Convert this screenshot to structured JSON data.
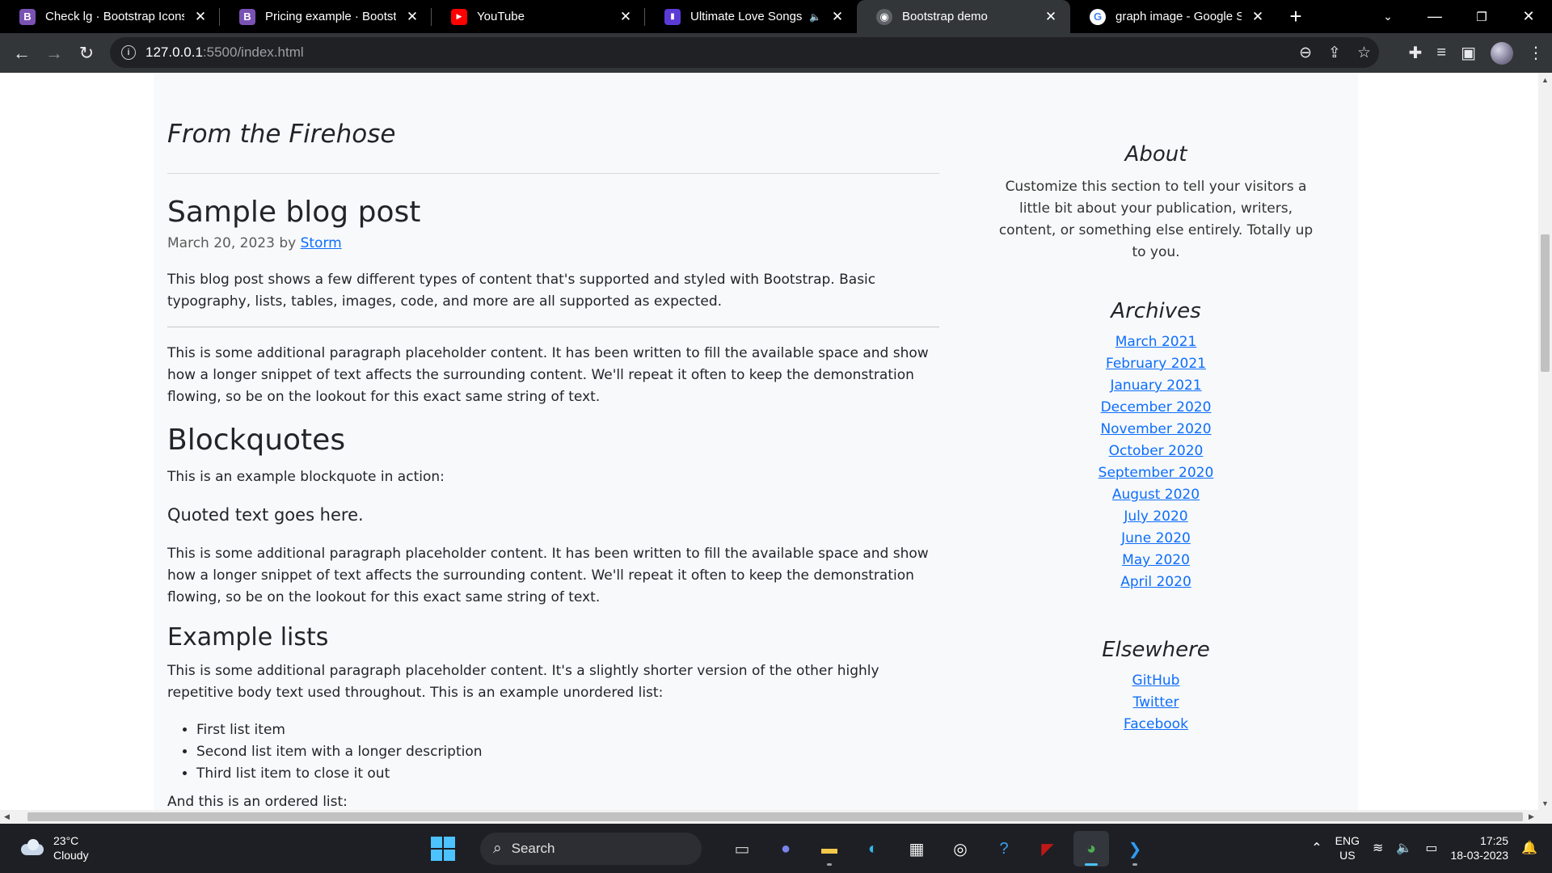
{
  "browser": {
    "tabs": [
      {
        "title": "Check lg · Bootstrap Icons",
        "favicon": "bootstrap-b-icon",
        "fav_color": "#7952b3",
        "fav_text": "B"
      },
      {
        "title": "Pricing example · Bootstrap",
        "favicon": "bootstrap-b-icon",
        "fav_color": "#7952b3",
        "fav_text": "B"
      },
      {
        "title": "YouTube",
        "favicon": "youtube-icon",
        "fav_color": "#ff0000",
        "fav_text": "▶"
      },
      {
        "title": "Ultimate Love Songs (H",
        "favicon": "music-icon",
        "fav_color": "#5b3bd6",
        "fav_text": "▮"
      },
      {
        "title": "Bootstrap demo",
        "favicon": "globe-icon",
        "fav_color": "#5f6368",
        "fav_text": "◉"
      },
      {
        "title": "graph image - Google Sear",
        "favicon": "google-icon",
        "fav_color": "#ffffff",
        "fav_text": "G"
      }
    ],
    "new_tab_label": "+",
    "url_host": "127.0.0.1",
    "url_rest": ":5500/index.html"
  },
  "page": {
    "firehose_heading": "From the Firehose",
    "post_title": "Sample blog post",
    "post_meta_prefix": "March 20, 2023 by",
    "post_author": "Storm",
    "intro": "This blog post shows a few different types of content that's supported and styled with Bootstrap. Basic typography, lists, tables, images, code, and more are all supported as expected.",
    "para1": "This is some additional paragraph placeholder content. It has been written to fill the available space and show how a longer snippet of text affects the surrounding content. We'll repeat it often to keep the demonstration flowing, so be on the lookout for this exact same string of text.",
    "blockquotes_heading": "Blockquotes",
    "blockquote_intro": "This is an example blockquote in action:",
    "quote": "Quoted text goes here.",
    "para2": "This is some additional paragraph placeholder content. It has been written to fill the available space and show how a longer snippet of text affects the surrounding content. We'll repeat it often to keep the demonstration flowing, so be on the lookout for this exact same string of text.",
    "lists_heading": "Example lists",
    "lists_intro": "This is some additional paragraph placeholder content. It's a slightly shorter version of the other highly repetitive body text used throughout. This is an example unordered list:",
    "list_items": [
      "First list item",
      "Second list item with a longer description",
      "Third list item to close it out"
    ],
    "cut_text": "And this is an ordered list:"
  },
  "sidebar": {
    "about_heading": "About",
    "about_text": "Customize this section to tell your visitors a little bit about your publication, writers, content, or something else entirely. Totally up to you.",
    "archives_heading": "Archives",
    "archives": [
      "March 2021",
      "February 2021",
      "January 2021",
      "December 2020",
      "November 2020",
      "October 2020",
      "September 2020",
      "August 2020",
      "July 2020",
      "June 2020",
      "May 2020",
      "April 2020"
    ],
    "elsewhere_heading": "Elsewhere",
    "elsewhere": [
      "GitHub",
      "Twitter",
      "Facebook"
    ]
  },
  "taskbar": {
    "temp": "23°C",
    "condition": "Cloudy",
    "search_placeholder": "Search",
    "lang_top": "ENG",
    "lang_bottom": "US",
    "time": "17:25",
    "date": "18-03-2023"
  }
}
